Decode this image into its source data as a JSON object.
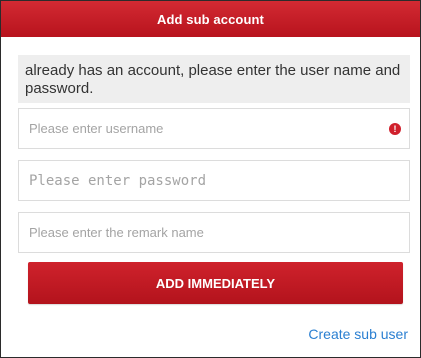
{
  "dialog": {
    "title": "Add sub account",
    "notice": "already has an account, please enter the user name and password."
  },
  "form": {
    "username": {
      "value": "",
      "placeholder": "Please enter username",
      "error_icon": "exclamation-circle-icon",
      "error_color": "#d0202c"
    },
    "password": {
      "value": "",
      "placeholder": "Please enter password"
    },
    "remark": {
      "value": "",
      "placeholder": "Please enter the remark name"
    }
  },
  "actions": {
    "add_label": "ADD IMMEDIATELY",
    "create_link_label": "Create sub user"
  },
  "colors": {
    "accent": "#c41a24",
    "link": "#2a7fd1",
    "notice_bg": "#eeeeee"
  }
}
